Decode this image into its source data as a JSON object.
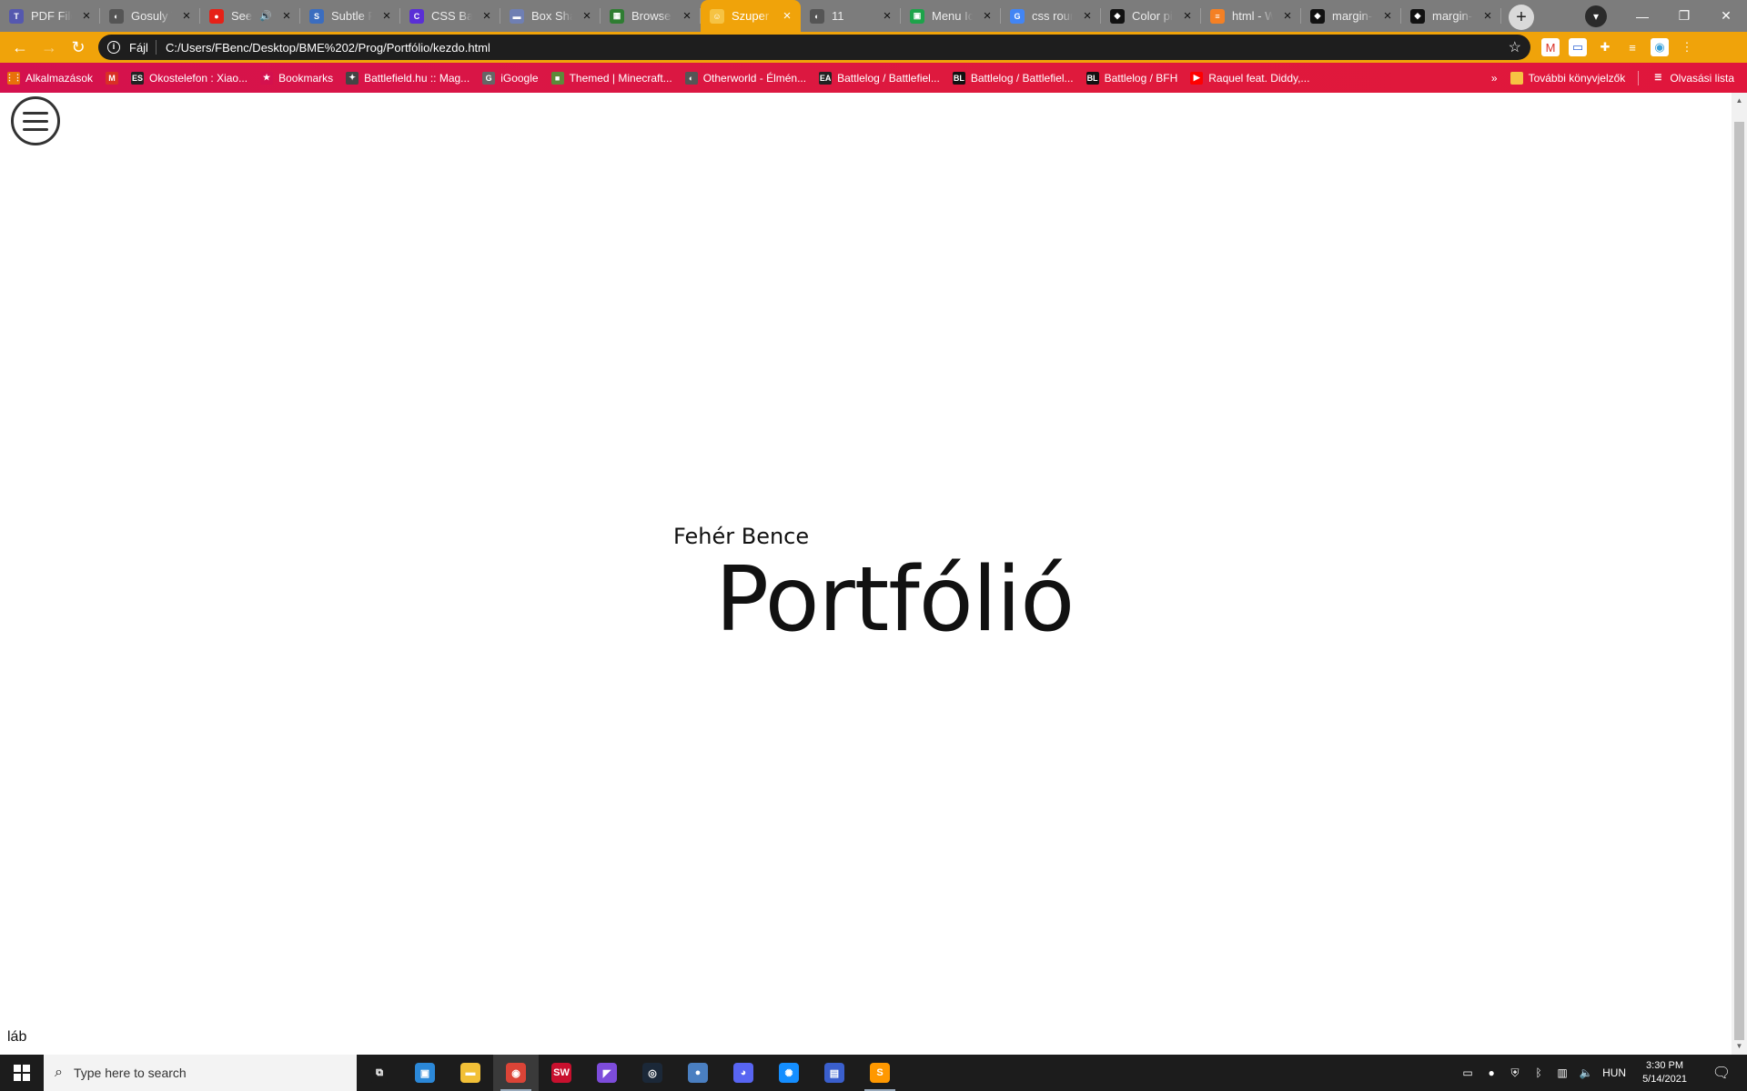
{
  "browser": {
    "tabs": [
      {
        "title": "PDF File",
        "favicon_text": "T",
        "favicon_color": "#5558af",
        "active": false
      },
      {
        "title": "Gosuly T",
        "favicon_text": "◐",
        "favicon_color": "#555555",
        "active": false
      },
      {
        "title": "Sees",
        "favicon_text": "●",
        "favicon_color": "#e62117",
        "active": false,
        "audio": "🔊"
      },
      {
        "title": "Subtle P",
        "favicon_text": "S",
        "favicon_color": "#3b6dbf",
        "active": false
      },
      {
        "title": "CSS Back",
        "favicon_text": "C",
        "favicon_color": "#5a2fd6",
        "active": false
      },
      {
        "title": "Box Sha",
        "favicon_text": "▬",
        "favicon_color": "#6f7fb3",
        "active": false
      },
      {
        "title": "Browse I",
        "favicon_text": "▦",
        "favicon_color": "#2f7d32",
        "active": false
      },
      {
        "title": "Szuper p",
        "favicon_text": "☺",
        "favicon_color": "#f6c343",
        "active": true
      },
      {
        "title": "11",
        "favicon_text": "◐",
        "favicon_color": "#555555",
        "active": false
      },
      {
        "title": "Menu Ic",
        "favicon_text": "▣",
        "favicon_color": "#1da34a",
        "active": false
      },
      {
        "title": "css roun",
        "favicon_text": "G",
        "favicon_color": "#4285f4",
        "active": false
      },
      {
        "title": "Color pic",
        "favicon_text": "◆",
        "favicon_color": "#111111",
        "active": false
      },
      {
        "title": "html - W",
        "favicon_text": "≡",
        "favicon_color": "#f48024",
        "active": false
      },
      {
        "title": "margin-l",
        "favicon_text": "◆",
        "favicon_color": "#111111",
        "active": false
      },
      {
        "title": "margin-l",
        "favicon_text": "◆",
        "favicon_color": "#111111",
        "active": false
      }
    ],
    "new_tab_label": "+",
    "address": {
      "scheme_label": "Fájl",
      "url": "C:/Users/FBenc/Desktop/BME%202/Prog/Portfólio/kezdo.html"
    },
    "extensions": [
      {
        "name": "gmail-extension-icon",
        "glyph": "M",
        "color": "#d93025"
      },
      {
        "name": "screen-extension-icon",
        "glyph": "▭",
        "color": "#3367d6"
      },
      {
        "name": "puzzle-extension-icon",
        "glyph": "✚",
        "color": "#f0a30a"
      },
      {
        "name": "reading-list-icon",
        "glyph": "≡",
        "color": "#f0a30a"
      },
      {
        "name": "profile-avatar-icon",
        "glyph": "◉",
        "color": "#3aa0d8"
      },
      {
        "name": "more-menu-icon",
        "glyph": "⋮",
        "color": "#f0a30a"
      }
    ],
    "bookmarks": [
      {
        "label": "Alkalmazások",
        "glyph": "⋮⋮",
        "color": "#e8710a"
      },
      {
        "label": "",
        "glyph": "M",
        "color": "#d93025"
      },
      {
        "label": "Okostelefon : Xiao...",
        "glyph": "ES",
        "color": "#222222"
      },
      {
        "label": "Bookmarks",
        "glyph": "★",
        "color": "#d4114e"
      },
      {
        "label": "Battlefield.hu :: Mag...",
        "glyph": "✦",
        "color": "#444444"
      },
      {
        "label": "iGoogle",
        "glyph": "G",
        "color": "#666666"
      },
      {
        "label": "Themed | Minecraft...",
        "glyph": "■",
        "color": "#5d8a3a"
      },
      {
        "label": "Otherworld - Élmén...",
        "glyph": "◐",
        "color": "#555555"
      },
      {
        "label": "Battlelog / Battlefiel...",
        "glyph": "EA",
        "color": "#222222"
      },
      {
        "label": "Battlelog / Battlefiel...",
        "glyph": "BL",
        "color": "#111111"
      },
      {
        "label": "Battlelog / BFH",
        "glyph": "BL",
        "color": "#111111"
      },
      {
        "label": "Raquel feat. Diddy,...",
        "glyph": "▶",
        "color": "#ff0000"
      }
    ],
    "bookmarks_overflow": "»",
    "other_bookmarks_label": "További könyvjelzők",
    "reading_list_label": "Olvasási lista"
  },
  "page": {
    "subtitle": "Fehér Bence",
    "title": "Portfólió",
    "footer": "láb"
  },
  "taskbar": {
    "search_placeholder": "Type here to search",
    "apps": [
      {
        "name": "task-view",
        "glyph": "⧉",
        "color": "#1c1c1c",
        "running": false
      },
      {
        "name": "windows-explorer-settings",
        "glyph": "▣",
        "color": "#2b88d8",
        "running": false
      },
      {
        "name": "file-explorer",
        "glyph": "▬",
        "color": "#f2c037",
        "running": false
      },
      {
        "name": "chrome",
        "glyph": "◉",
        "color": "#db4437",
        "running": true,
        "focused": true
      },
      {
        "name": "solidworks-2020",
        "glyph": "SW",
        "color": "#c8102e",
        "running": false
      },
      {
        "name": "visual-studio",
        "glyph": "◤",
        "color": "#7d4cdb",
        "running": false
      },
      {
        "name": "steam",
        "glyph": "◎",
        "color": "#1b2838",
        "running": false
      },
      {
        "name": "drop-app",
        "glyph": "●",
        "color": "#4a7fc1",
        "running": false
      },
      {
        "name": "discord",
        "glyph": "◕",
        "color": "#5865f2",
        "running": false
      },
      {
        "name": "battlenet",
        "glyph": "✺",
        "color": "#148eff",
        "running": false
      },
      {
        "name": "save-app",
        "glyph": "▤",
        "color": "#3a5fcd",
        "running": false
      },
      {
        "name": "sublime-text",
        "glyph": "S",
        "color": "#ff9800",
        "running": true
      }
    ],
    "tray": {
      "language": "HUN",
      "time": "3:30 PM",
      "date": "5/14/2021"
    }
  }
}
